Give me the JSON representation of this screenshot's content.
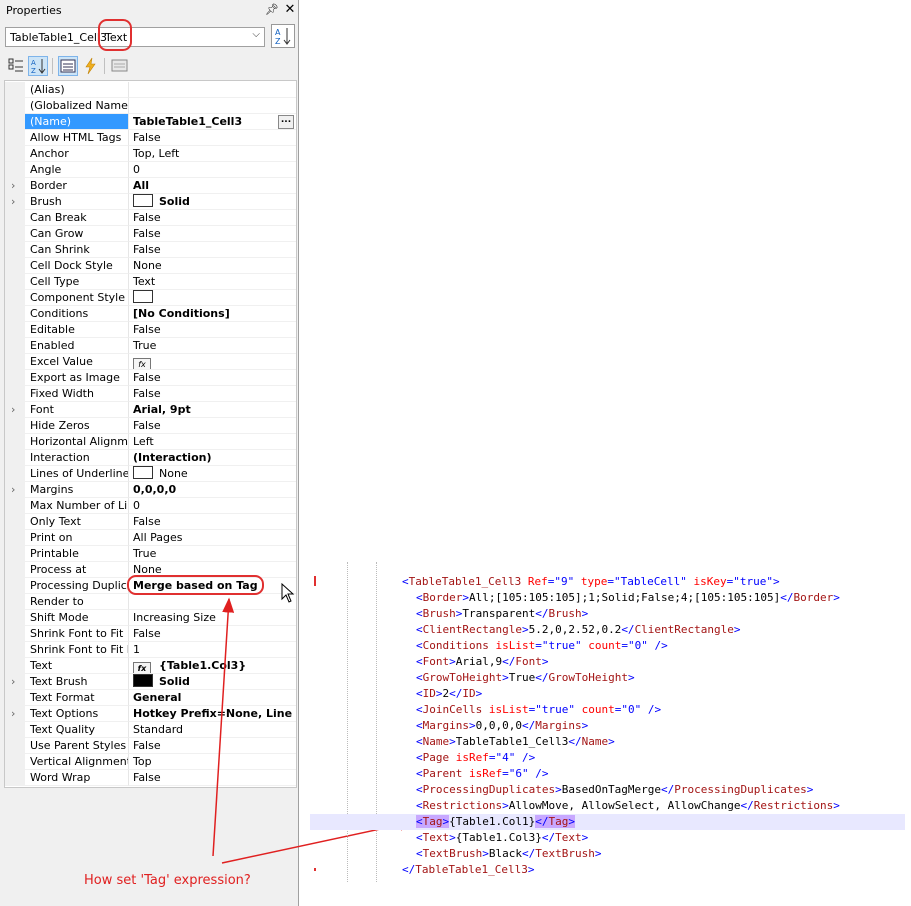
{
  "panel": {
    "title": "Properties",
    "pin_icon": "pin-icon",
    "close_icon": "close-icon",
    "object_name": "TableTable1_Cell3",
    "object_type": "Text",
    "sort_icon": "sort-az-icon"
  },
  "properties": [
    {
      "name": "(Alias)",
      "value": ""
    },
    {
      "name": "(Globalized Name)",
      "value": ""
    },
    {
      "name": "(Name)",
      "value": "TableTable1_Cell3",
      "bold": true,
      "selected": true,
      "button": "..."
    },
    {
      "name": "Allow HTML Tags",
      "value": "False"
    },
    {
      "name": "Anchor",
      "value": "Top, Left"
    },
    {
      "name": "Angle",
      "value": "0"
    },
    {
      "name": "Border",
      "value": "All",
      "bold": true,
      "expandable": true
    },
    {
      "name": "Brush",
      "value": "Solid",
      "bold": true,
      "expandable": true,
      "swatch": "#ffffff"
    },
    {
      "name": "Can Break",
      "value": "False"
    },
    {
      "name": "Can Grow",
      "value": "False"
    },
    {
      "name": "Can Shrink",
      "value": "False"
    },
    {
      "name": "Cell Dock Style",
      "value": "None"
    },
    {
      "name": "Cell Type",
      "value": "Text"
    },
    {
      "name": "Component Style",
      "value": "",
      "swatch": "#ffffff"
    },
    {
      "name": "Conditions",
      "value": "[No Conditions]",
      "bold": true
    },
    {
      "name": "Editable",
      "value": "False"
    },
    {
      "name": "Enabled",
      "value": "True"
    },
    {
      "name": "Excel Value",
      "value": "",
      "fx": true
    },
    {
      "name": "Export as Image",
      "value": "False"
    },
    {
      "name": "Fixed Width",
      "value": "False"
    },
    {
      "name": "Font",
      "value": "Arial, 9pt",
      "bold": true,
      "expandable": true
    },
    {
      "name": "Hide Zeros",
      "value": "False"
    },
    {
      "name": "Horizontal Alignment",
      "value": "Left"
    },
    {
      "name": "Interaction",
      "value": "(Interaction)",
      "bold": true
    },
    {
      "name": "Lines of Underline",
      "value": "None",
      "swatch": "#ffffff"
    },
    {
      "name": "Margins",
      "value": "0,0,0,0",
      "bold": true,
      "expandable": true
    },
    {
      "name": "Max Number of Lines",
      "value": "0"
    },
    {
      "name": "Only Text",
      "value": "False"
    },
    {
      "name": "Print on",
      "value": "All Pages"
    },
    {
      "name": "Printable",
      "value": "True"
    },
    {
      "name": "Process at",
      "value": "None"
    },
    {
      "name": "Processing Duplicates",
      "value": "Merge based on Tag",
      "bold": true
    },
    {
      "name": "Render to",
      "value": ""
    },
    {
      "name": "Shift Mode",
      "value": "Increasing Size"
    },
    {
      "name": "Shrink Font to Fit",
      "value": "False"
    },
    {
      "name": "Shrink Font to Fit Min",
      "value": "1"
    },
    {
      "name": "Text",
      "value": "{Table1.Col3}",
      "bold": true,
      "fx": true
    },
    {
      "name": "Text Brush",
      "value": "Solid",
      "bold": true,
      "expandable": true,
      "swatch": "#000000"
    },
    {
      "name": "Text Format",
      "value": "General",
      "bold": true
    },
    {
      "name": "Text Options",
      "value": "Hotkey Prefix=None, Line Limit",
      "bold": true,
      "expandable": true
    },
    {
      "name": "Text Quality",
      "value": "Standard"
    },
    {
      "name": "Use Parent Styles",
      "value": "False"
    },
    {
      "name": "Vertical Alignment",
      "value": "Top"
    },
    {
      "name": "Word Wrap",
      "value": "False"
    }
  ],
  "annotation": {
    "question": "How set 'Tag' expression?",
    "color": "#e02020"
  },
  "xml_lines": [
    {
      "indent": 0,
      "parts": [
        [
          "b",
          "<"
        ],
        [
          "t",
          "TableTable1_Cell3"
        ],
        [
          "s",
          " "
        ],
        [
          "a",
          "Ref"
        ],
        [
          "b",
          "=\""
        ],
        [
          "v",
          "9"
        ],
        [
          "b",
          "\" "
        ],
        [
          "a",
          "type"
        ],
        [
          "b",
          "=\""
        ],
        [
          "v",
          "TableCell"
        ],
        [
          "b",
          "\" "
        ],
        [
          "a",
          "isKey"
        ],
        [
          "b",
          "=\""
        ],
        [
          "v",
          "true"
        ],
        [
          "b",
          "\">"
        ]
      ]
    },
    {
      "indent": 1,
      "parts": [
        [
          "b",
          "<"
        ],
        [
          "t",
          "Border"
        ],
        [
          "b",
          ">"
        ],
        [
          "x",
          "All;[105:105:105];1;Solid;False;4;[105:105:105]"
        ],
        [
          "b",
          "</"
        ],
        [
          "t",
          "Border"
        ],
        [
          "b",
          ">"
        ]
      ]
    },
    {
      "indent": 1,
      "parts": [
        [
          "b",
          "<"
        ],
        [
          "t",
          "Brush"
        ],
        [
          "b",
          ">"
        ],
        [
          "x",
          "Transparent"
        ],
        [
          "b",
          "</"
        ],
        [
          "t",
          "Brush"
        ],
        [
          "b",
          ">"
        ]
      ]
    },
    {
      "indent": 1,
      "parts": [
        [
          "b",
          "<"
        ],
        [
          "t",
          "ClientRectangle"
        ],
        [
          "b",
          ">"
        ],
        [
          "x",
          "5.2,0,2.52,0.2"
        ],
        [
          "b",
          "</"
        ],
        [
          "t",
          "ClientRectangle"
        ],
        [
          "b",
          ">"
        ]
      ]
    },
    {
      "indent": 1,
      "parts": [
        [
          "b",
          "<"
        ],
        [
          "t",
          "Conditions"
        ],
        [
          "s",
          " "
        ],
        [
          "a",
          "isList"
        ],
        [
          "b",
          "=\""
        ],
        [
          "v",
          "true"
        ],
        [
          "b",
          "\" "
        ],
        [
          "a",
          "count"
        ],
        [
          "b",
          "=\""
        ],
        [
          "v",
          "0"
        ],
        [
          "b",
          "\" />"
        ]
      ]
    },
    {
      "indent": 1,
      "parts": [
        [
          "b",
          "<"
        ],
        [
          "t",
          "Font"
        ],
        [
          "b",
          ">"
        ],
        [
          "x",
          "Arial,9"
        ],
        [
          "b",
          "</"
        ],
        [
          "t",
          "Font"
        ],
        [
          "b",
          ">"
        ]
      ]
    },
    {
      "indent": 1,
      "parts": [
        [
          "b",
          "<"
        ],
        [
          "t",
          "GrowToHeight"
        ],
        [
          "b",
          ">"
        ],
        [
          "x",
          "True"
        ],
        [
          "b",
          "</"
        ],
        [
          "t",
          "GrowToHeight"
        ],
        [
          "b",
          ">"
        ]
      ]
    },
    {
      "indent": 1,
      "parts": [
        [
          "b",
          "<"
        ],
        [
          "t",
          "ID"
        ],
        [
          "b",
          ">"
        ],
        [
          "x",
          "2"
        ],
        [
          "b",
          "</"
        ],
        [
          "t",
          "ID"
        ],
        [
          "b",
          ">"
        ]
      ]
    },
    {
      "indent": 1,
      "parts": [
        [
          "b",
          "<"
        ],
        [
          "t",
          "JoinCells"
        ],
        [
          "s",
          " "
        ],
        [
          "a",
          "isList"
        ],
        [
          "b",
          "=\""
        ],
        [
          "v",
          "true"
        ],
        [
          "b",
          "\" "
        ],
        [
          "a",
          "count"
        ],
        [
          "b",
          "=\""
        ],
        [
          "v",
          "0"
        ],
        [
          "b",
          "\" />"
        ]
      ]
    },
    {
      "indent": 1,
      "parts": [
        [
          "b",
          "<"
        ],
        [
          "t",
          "Margins"
        ],
        [
          "b",
          ">"
        ],
        [
          "x",
          "0,0,0,0"
        ],
        [
          "b",
          "</"
        ],
        [
          "t",
          "Margins"
        ],
        [
          "b",
          ">"
        ]
      ]
    },
    {
      "indent": 1,
      "parts": [
        [
          "b",
          "<"
        ],
        [
          "t",
          "Name"
        ],
        [
          "b",
          ">"
        ],
        [
          "x",
          "TableTable1_Cell3"
        ],
        [
          "b",
          "</"
        ],
        [
          "t",
          "Name"
        ],
        [
          "b",
          ">"
        ]
      ]
    },
    {
      "indent": 1,
      "parts": [
        [
          "b",
          "<"
        ],
        [
          "t",
          "Page"
        ],
        [
          "s",
          " "
        ],
        [
          "a",
          "isRef"
        ],
        [
          "b",
          "=\""
        ],
        [
          "v",
          "4"
        ],
        [
          "b",
          "\" />"
        ]
      ]
    },
    {
      "indent": 1,
      "parts": [
        [
          "b",
          "<"
        ],
        [
          "t",
          "Parent"
        ],
        [
          "s",
          " "
        ],
        [
          "a",
          "isRef"
        ],
        [
          "b",
          "=\""
        ],
        [
          "v",
          "6"
        ],
        [
          "b",
          "\" />"
        ]
      ]
    },
    {
      "indent": 1,
      "parts": [
        [
          "b",
          "<"
        ],
        [
          "t",
          "ProcessingDuplicates"
        ],
        [
          "b",
          ">"
        ],
        [
          "x",
          "BasedOnTagMerge"
        ],
        [
          "b",
          "</"
        ],
        [
          "t",
          "ProcessingDuplicates"
        ],
        [
          "b",
          ">"
        ]
      ]
    },
    {
      "indent": 1,
      "parts": [
        [
          "b",
          "<"
        ],
        [
          "t",
          "Restrictions"
        ],
        [
          "b",
          ">"
        ],
        [
          "x",
          "AllowMove, AllowSelect, AllowChange"
        ],
        [
          "b",
          "</"
        ],
        [
          "t",
          "Restrictions"
        ],
        [
          "b",
          ">"
        ]
      ]
    },
    {
      "indent": 1,
      "highlight": true,
      "parts": [
        [
          "B",
          "<"
        ],
        [
          "T",
          "Tag"
        ],
        [
          "B",
          ">"
        ],
        [
          "x",
          "{Table1.Col1}"
        ],
        [
          "B",
          "</"
        ],
        [
          "T",
          "Tag"
        ],
        [
          "B",
          ">"
        ]
      ]
    },
    {
      "indent": 1,
      "parts": [
        [
          "b",
          "<"
        ],
        [
          "t",
          "Text"
        ],
        [
          "b",
          ">"
        ],
        [
          "x",
          "{Table1.Col3}"
        ],
        [
          "b",
          "</"
        ],
        [
          "t",
          "Text"
        ],
        [
          "b",
          ">"
        ]
      ]
    },
    {
      "indent": 1,
      "parts": [
        [
          "b",
          "<"
        ],
        [
          "t",
          "TextBrush"
        ],
        [
          "b",
          ">"
        ],
        [
          "x",
          "Black"
        ],
        [
          "b",
          "</"
        ],
        [
          "t",
          "TextBrush"
        ],
        [
          "b",
          ">"
        ]
      ]
    },
    {
      "indent": 0,
      "parts": [
        [
          "b",
          "</"
        ],
        [
          "t",
          "TableTable1_Cell3"
        ],
        [
          "b",
          ">"
        ]
      ]
    }
  ]
}
